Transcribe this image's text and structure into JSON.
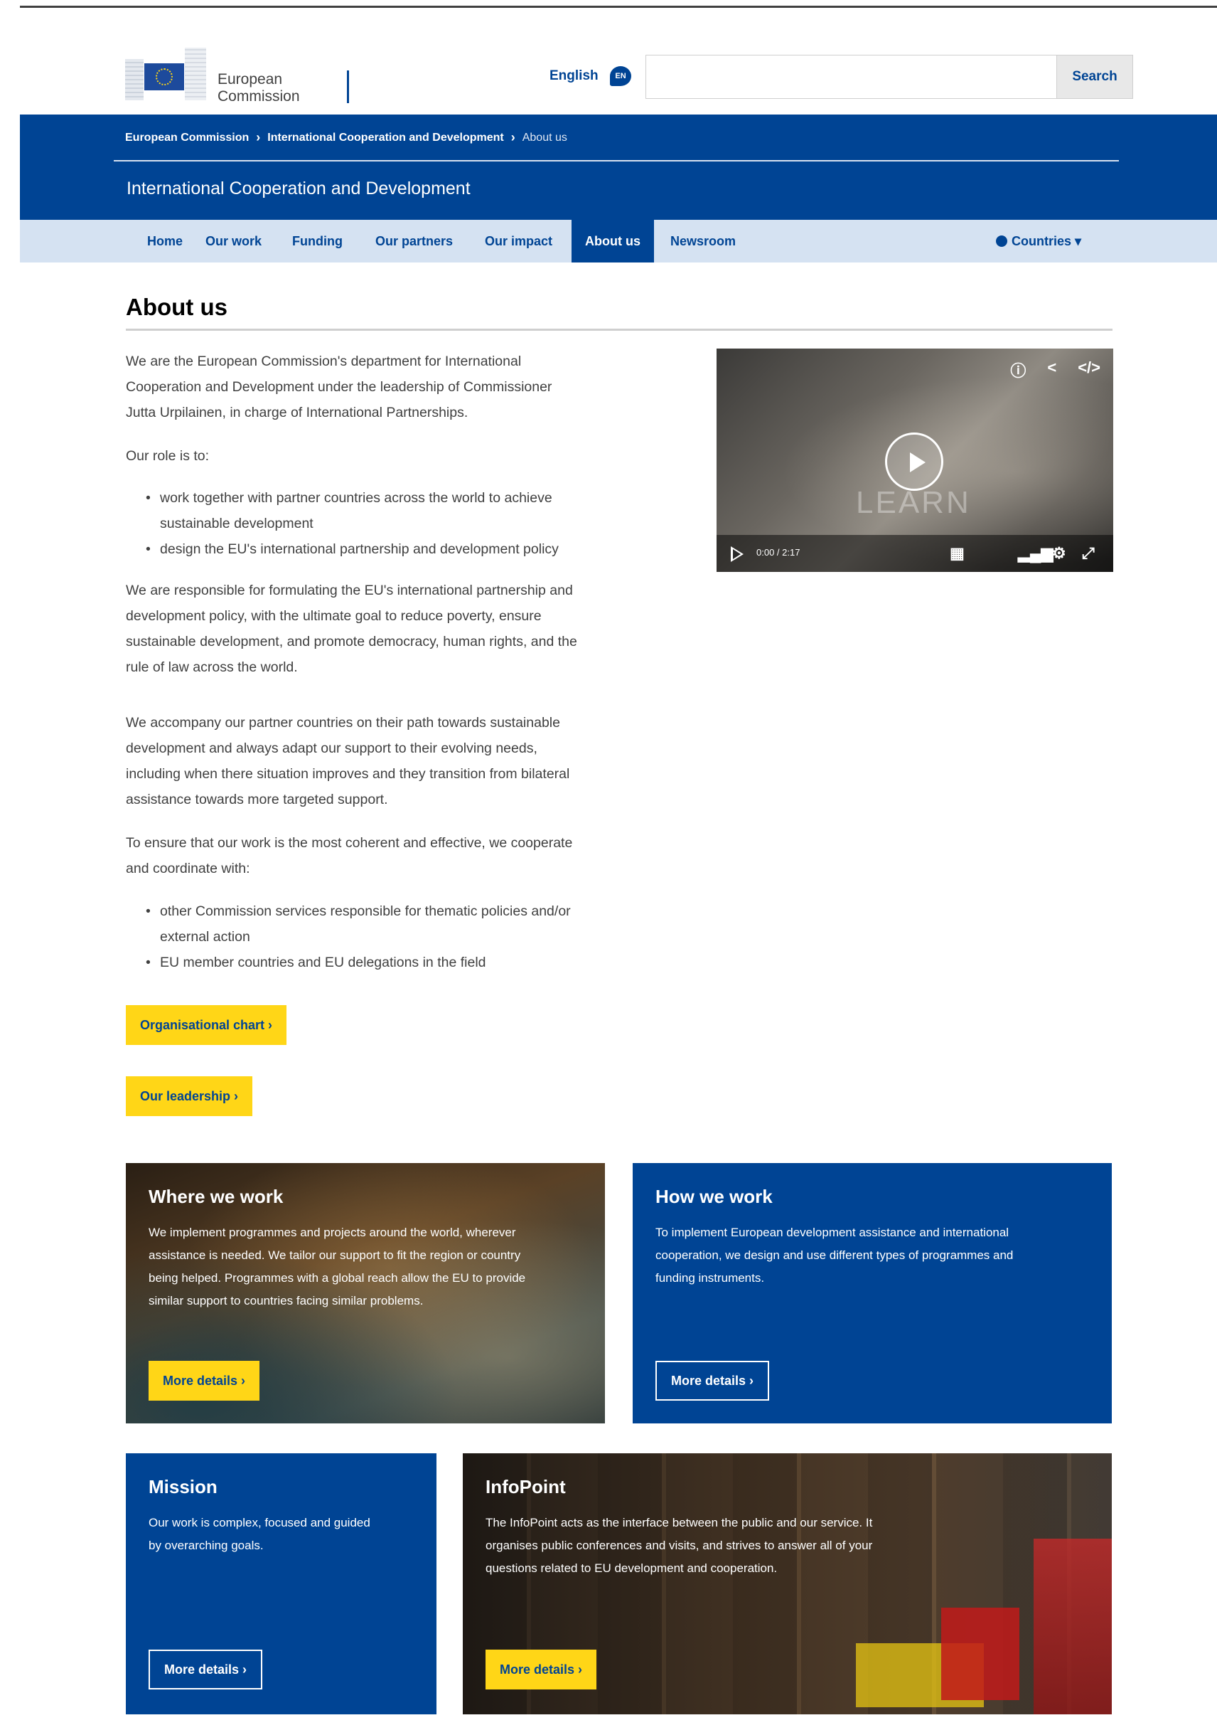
{
  "header": {
    "logo_text_line1": "European",
    "logo_text_line2": "Commission",
    "language_label": "English",
    "language_code": "EN",
    "search_placeholder": "",
    "search_button": "Search"
  },
  "breadcrumb": {
    "items": [
      "European Commission",
      "International Cooperation and Development"
    ],
    "current": "About us",
    "separator": "›"
  },
  "site_title": "International Cooperation and Development",
  "nav": {
    "items": [
      "Home",
      "Our work",
      "Funding",
      "Our partners",
      "Our impact",
      "About us",
      "Newsroom"
    ],
    "active": "About us",
    "countries_label": "Countries ▾"
  },
  "page": {
    "title": "About us",
    "intro_lines": [
      "We are the European Commission's department for International",
      "Cooperation and Development under the leadership of Commissioner",
      "Jutta Urpilainen, in charge of International Partnerships."
    ],
    "role_label": "Our role is to:",
    "role_bullets": [
      [
        "work together with partner countries across the world to achieve",
        "sustainable development"
      ],
      [
        "design the EU's international partnership and development policy"
      ]
    ],
    "responsible_lines": [
      "We are responsible for formulating the EU's international partnership and",
      "development policy, with the ultimate goal to reduce poverty, ensure",
      "sustainable development, and promote democracy, human rights, and the",
      "rule of law across the world."
    ],
    "accompany_lines": [
      "We accompany our partner countries on their path towards sustainable",
      "development and always adapt our support to their evolving needs,",
      "including when there situation improves and they transition from bilateral",
      "assistance towards more targeted support."
    ],
    "ensure_lines": [
      "To ensure that our work is the most coherent and effective, we cooperate",
      "and coordinate with:"
    ],
    "coordinate_bullets": [
      [
        "other Commission services responsible for thematic policies and/or",
        "external action"
      ],
      [
        "EU member countries and EU delegations in the field"
      ]
    ],
    "cta_org_chart": "Organisational chart  ›",
    "cta_leadership": "Our leadership  ›"
  },
  "video": {
    "overlay_word": "LEARN",
    "time": "0:00 / 2:17",
    "icons": [
      "info-icon",
      "share-icon",
      "embed-icon",
      "play-icon",
      "subtitles-icon",
      "volume-icon",
      "settings-icon",
      "fullscreen-icon"
    ]
  },
  "cards": {
    "where": {
      "title": "Where we work",
      "lines": [
        "We implement programmes and projects around the world, wherever",
        "assistance is needed. We tailor our support to fit the region or country",
        "being helped. Programmes with a global reach allow the EU to provide",
        "similar support to countries facing similar problems."
      ],
      "button": "More details  ›"
    },
    "how": {
      "title": "How we work",
      "lines": [
        "To implement European development assistance and international",
        "cooperation, we design and use different types of programmes and",
        "funding instruments."
      ],
      "button": "More details  ›"
    },
    "mission": {
      "title": "Mission",
      "lines": [
        "Our work is complex, focused and guided",
        "by overarching goals."
      ],
      "button": "More details  ›"
    },
    "infopoint": {
      "title": "InfoPoint",
      "lines": [
        "The InfoPoint acts as the interface between the public and our service. It",
        "organises public conferences and visits, and strives to answer all of your",
        "questions related to EU development and cooperation."
      ],
      "button": "More details  ›"
    }
  },
  "colors": {
    "ec_blue": "#004494",
    "ec_yellow": "#ffd617",
    "nav_bg": "#d5e2f2"
  }
}
